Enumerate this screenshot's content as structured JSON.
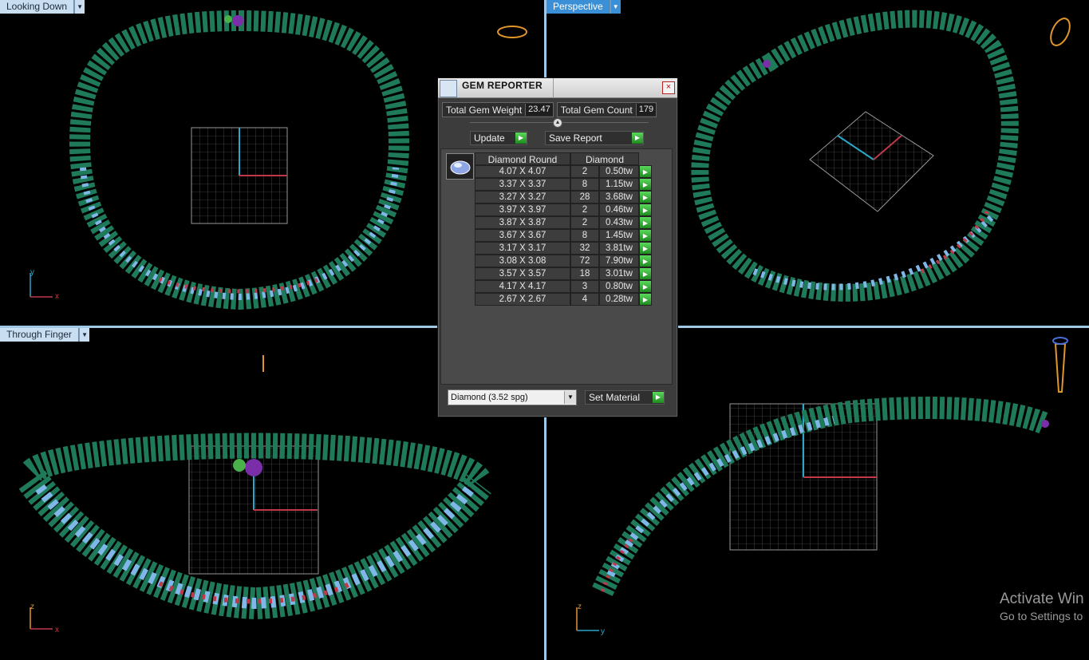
{
  "viewports": {
    "top_left": {
      "label": "Looking Down",
      "axes": {
        "a": "y",
        "b": "x"
      }
    },
    "top_right": {
      "label": "Perspective"
    },
    "bottom_left": {
      "label": "Through Finger",
      "axes": {
        "a": "z",
        "b": "x"
      }
    },
    "bottom_right": {
      "axes": {
        "a": "z",
        "b": "y"
      }
    }
  },
  "gem_reporter": {
    "title": "GEM REPORTER",
    "close": "×",
    "total_weight_label": "Total Gem Weight",
    "total_weight_value": "23.47",
    "total_count_label": "Total Gem Count",
    "total_count_value": "179",
    "update_label": "Update",
    "save_label": "Save Report",
    "col_shape": "Diamond Round",
    "col_material": "Diamond",
    "rows": [
      {
        "size": "4.07 X 4.07",
        "count": "2",
        "weight": "0.50tw"
      },
      {
        "size": "3.37 X 3.37",
        "count": "8",
        "weight": "1.15tw"
      },
      {
        "size": "3.27 X 3.27",
        "count": "28",
        "weight": "3.68tw"
      },
      {
        "size": "3.97 X 3.97",
        "count": "2",
        "weight": "0.46tw"
      },
      {
        "size": "3.87 X 3.87",
        "count": "2",
        "weight": "0.43tw"
      },
      {
        "size": "3.67 X 3.67",
        "count": "8",
        "weight": "1.45tw"
      },
      {
        "size": "3.17 X 3.17",
        "count": "32",
        "weight": "3.81tw"
      },
      {
        "size": "3.08 X 3.08",
        "count": "72",
        "weight": "7.90tw"
      },
      {
        "size": "3.57 X 3.57",
        "count": "18",
        "weight": "3.01tw"
      },
      {
        "size": "4.17 X 4.17",
        "count": "3",
        "weight": "0.80tw"
      },
      {
        "size": "2.67 X 2.67",
        "count": "4",
        "weight": "0.28tw"
      }
    ],
    "material_select": "Diamond    (3.52 spg)",
    "set_material_label": "Set Material"
  },
  "watermark": {
    "line1": "Activate Win",
    "line2": "Go to Settings to"
  },
  "colors": {
    "leaf": "#1f7a5a",
    "gem": "#7fb8e8",
    "accent_red": "#c0394a",
    "purple": "#7a2fa8",
    "grid": "#8a8a8a",
    "divider": "#9fc7e6"
  }
}
